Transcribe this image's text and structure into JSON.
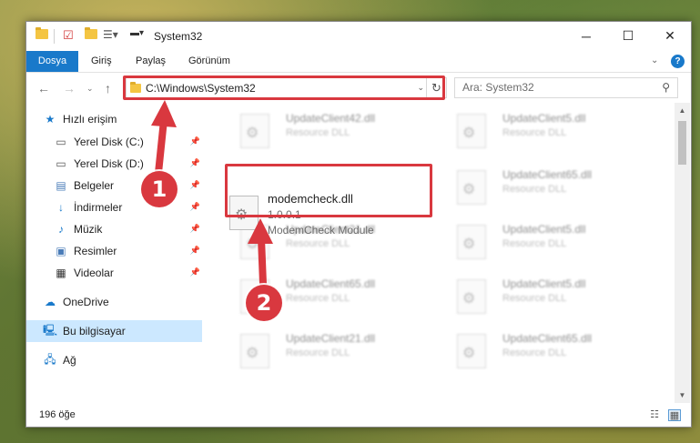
{
  "window": {
    "title": "System32",
    "controls": {
      "minimize": "─",
      "maximize": "☐",
      "close": "✕"
    }
  },
  "ribbon": {
    "tabs": [
      "Dosya",
      "Giriş",
      "Paylaş",
      "Görünüm"
    ]
  },
  "address": {
    "path": "C:\\Windows\\System32",
    "search_placeholder": "Ara: System32"
  },
  "sidebar": {
    "items": [
      {
        "label": "Hızlı erişim",
        "icon": "star-icon"
      },
      {
        "label": "Yerel Disk (C:)",
        "icon": "drive-icon",
        "pinned": true
      },
      {
        "label": "Yerel Disk (D:)",
        "icon": "drive-icon",
        "pinned": true
      },
      {
        "label": "Belgeler",
        "icon": "documents-icon",
        "pinned": true
      },
      {
        "label": "İndirmeler",
        "icon": "download-icon",
        "pinned": true
      },
      {
        "label": "Müzik",
        "icon": "music-icon",
        "pinned": true
      },
      {
        "label": "Resimler",
        "icon": "pictures-icon",
        "pinned": true
      },
      {
        "label": "Videolar",
        "icon": "video-icon",
        "pinned": true
      },
      {
        "label": "OneDrive",
        "icon": "cloud-icon"
      },
      {
        "label": "Bu bilgisayar",
        "icon": "computer-icon",
        "selected": true
      },
      {
        "label": "Ağ",
        "icon": "network-icon"
      }
    ]
  },
  "files": {
    "selected": {
      "name": "modemcheck.dll",
      "version": "1.0.0.1",
      "description": "ModemCheck Module"
    },
    "blurred": [
      {
        "name": "UpdateClient42.dll",
        "desc": "Resource DLL"
      },
      {
        "name": "UpdateClient5.dll",
        "desc": "Resource DLL"
      },
      {
        "name": "UpdateClient65.dll",
        "desc": "Resource DLL"
      },
      {
        "name": "UpdateClient21.dll",
        "desc": "Resource DLL"
      },
      {
        "name": "UpdateClient5.dll",
        "desc": "Resource DLL"
      },
      {
        "name": "UpdateClient65.dll",
        "desc": "Resource DLL"
      },
      {
        "name": "UpdateClient5.dll",
        "desc": "Resource DLL"
      },
      {
        "name": "UpdateClient21.dll",
        "desc": "Resource DLL"
      },
      {
        "name": "UpdateClient65.dll",
        "desc": "Resource DLL"
      }
    ]
  },
  "status": {
    "count": "196 öğe"
  },
  "annotations": {
    "step1": "1",
    "step2": "2",
    "color": "#d9383f"
  },
  "colors": {
    "accent": "#1979ca",
    "selected_nav": "#cce8ff"
  }
}
